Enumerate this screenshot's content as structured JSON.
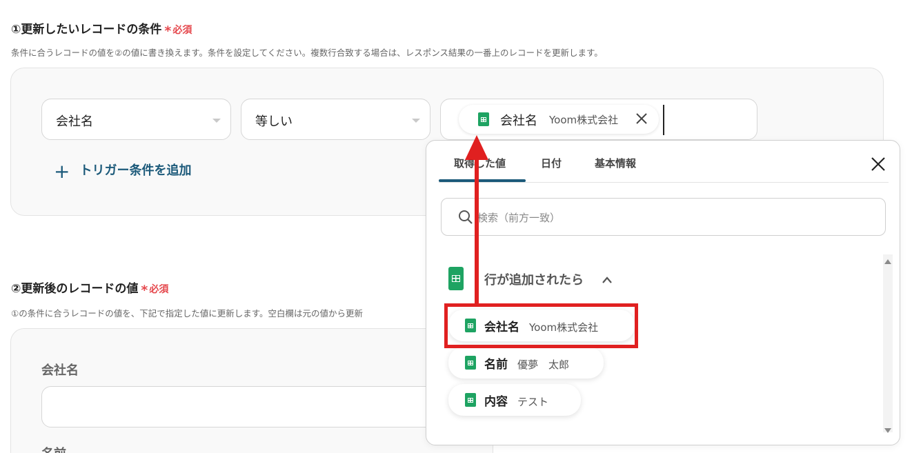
{
  "section1": {
    "title": "①更新したいレコードの条件",
    "required": "必須",
    "required_star": "*",
    "description": "条件に合うレコードの値を②の値に書き換えます。条件を設定してください。複数行合致する場合は、レスポンス結果の一番上のレコードを更新します。",
    "field_select": "会社名",
    "operator_select": "等しい",
    "value_tag": {
      "name": "会社名",
      "value": "Yoom株式会社"
    },
    "add_trigger": "トリガー条件を追加",
    "add_trigger_icon": "+"
  },
  "section2": {
    "title": "②更新後のレコードの値",
    "required": "必須",
    "required_star": "*",
    "description": "①の条件に合うレコードの値を、下記で指定した値に更新します。空白欄は元の値から更新",
    "field1_label": "会社名",
    "field2_label": "名前"
  },
  "dropdown": {
    "tabs": [
      "取得した値",
      "日付",
      "基本情報"
    ],
    "active_tab": 0,
    "close_icon": "×",
    "search_placeholder": "検索（前方一致）",
    "group_title": "行が追加されたら",
    "items": [
      {
        "name": "会社名",
        "value": "Yoom株式会社"
      },
      {
        "name": "名前",
        "value": "優夢　太郎"
      },
      {
        "name": "内容",
        "value": "テスト"
      }
    ]
  },
  "colors": {
    "required": "#e5484d",
    "link": "#1c5a7a",
    "sheet": "#1ea362",
    "annotation": "#e02020"
  }
}
